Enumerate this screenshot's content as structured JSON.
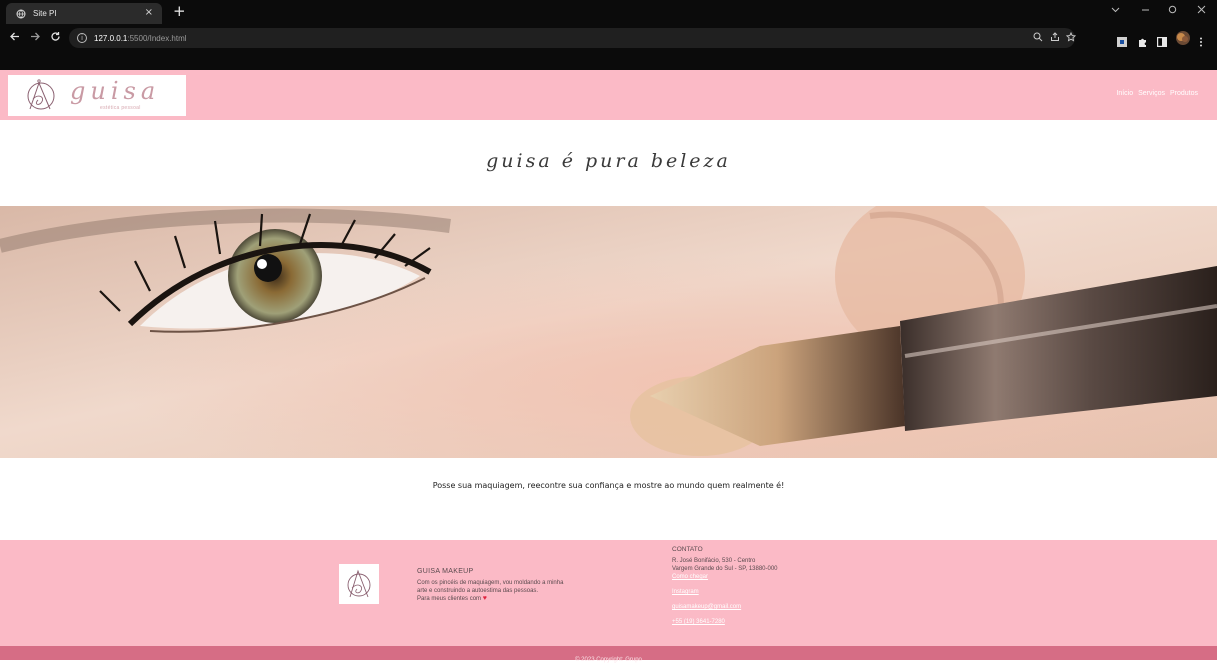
{
  "browser": {
    "tab_title": "Site PI",
    "tab_close": "×",
    "new_tab": "+",
    "url_host": "127.0.0.1",
    "url_rest": ":5500/Index.html",
    "icons": [
      "globe-icon",
      "back-icon",
      "forward-icon",
      "reload-icon",
      "info-icon",
      "zoom-icon",
      "share-icon",
      "star-icon",
      "extension-icon",
      "puzzle-icon",
      "sidepanel-icon",
      "profile-icon",
      "menu-icon"
    ],
    "window_controls": [
      "chevron-down-icon",
      "minimize-icon",
      "restore-icon",
      "close-icon"
    ]
  },
  "header": {
    "logo_word": "guisa",
    "logo_tagline": "estética pessoal",
    "nav": [
      "Início",
      "Serviços",
      "Produtos"
    ]
  },
  "hero": {
    "tagline": "guisa é pura beleza",
    "caption": "Posse sua maquiagem, reecontre sua confiança e mostre ao mundo quem realmente é!"
  },
  "footer": {
    "brand_title": "GUISA MAKEUP",
    "brand_line1": "Com os pincéis de maquiagem, vou moldando a minha",
    "brand_line2": "arte e construindo a autoestima das pessoas.",
    "brand_line3": "Para meus clientes com",
    "contact_title": "CONTATO",
    "address_line1": "R. José Bonifácio, 530 - Centro",
    "address_line2": "Vargem Grande do Sul - SP, 13880-000",
    "map_link": "Como chegar",
    "instagram": "Instagram",
    "email": "guisamakeup@gmail.com",
    "phone": "+55 (19) 3641-7280",
    "copyright": "© 2023 Copyright: Grupo"
  },
  "colors": {
    "brand_pink": "#fbbac6",
    "copyright_pink": "#d66d85",
    "chrome_dark": "#0b0b0b"
  }
}
